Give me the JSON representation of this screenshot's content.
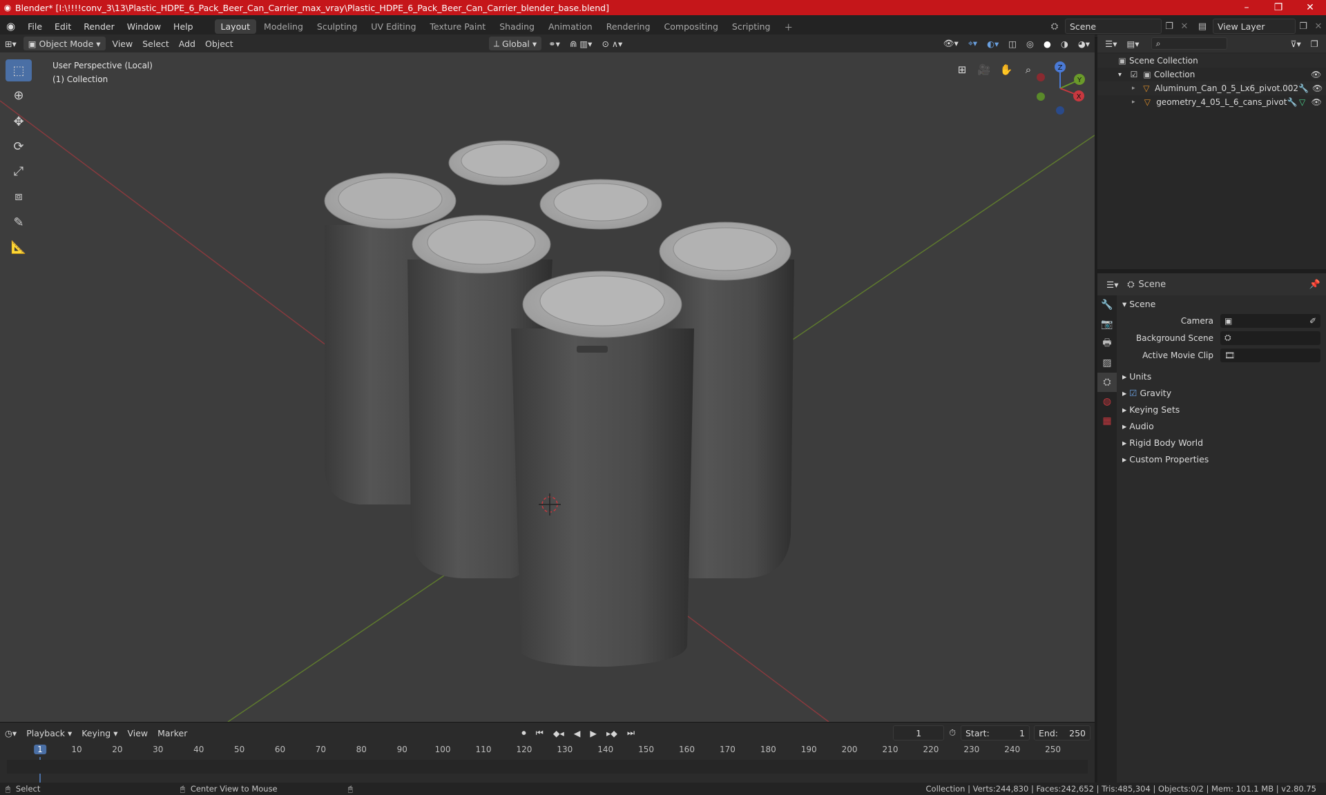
{
  "titlebar": {
    "title": "Blender* [I:\\!!!!conv_3\\13\\Plastic_HDPE_6_Pack_Beer_Can_Carrier_max_vray\\Plastic_HDPE_6_Pack_Beer_Can_Carrier_blender_base.blend]",
    "minimize": "–",
    "maximize": "❐",
    "close": "✕"
  },
  "menu": {
    "items": [
      "File",
      "Edit",
      "Render",
      "Window",
      "Help"
    ],
    "workspaces": [
      "Layout",
      "Modeling",
      "Sculpting",
      "UV Editing",
      "Texture Paint",
      "Shading",
      "Animation",
      "Rendering",
      "Compositing",
      "Scripting"
    ],
    "active_workspace": "Layout",
    "scene_label": "Scene",
    "view_layer_label": "View Layer"
  },
  "viewport_header": {
    "mode": "Object Mode",
    "menus": [
      "View",
      "Select",
      "Add",
      "Object"
    ],
    "transform": "Global"
  },
  "viewport": {
    "perspective": "User Perspective (Local)",
    "collection": "(1) Collection",
    "axis_x": "X",
    "axis_y": "Y",
    "axis_z": "Z"
  },
  "outliner": {
    "root": "Scene Collection",
    "collection": "Collection",
    "objects": [
      "Aluminum_Can_0_5_Lx6_pivot.002",
      "geometry_4_05_L_6_cans_pivot"
    ]
  },
  "properties": {
    "header": "Scene",
    "section": "Scene",
    "fields": [
      {
        "label": "Camera",
        "value": ""
      },
      {
        "label": "Background Scene",
        "value": ""
      },
      {
        "label": "Active Movie Clip",
        "value": ""
      }
    ],
    "panels": [
      "Units",
      "Gravity",
      "Keying Sets",
      "Audio",
      "Rigid Body World",
      "Custom Properties"
    ],
    "gravity_checked": true
  },
  "timeline": {
    "menus": [
      "Playback",
      "Keying",
      "View",
      "Marker"
    ],
    "current_frame": "1",
    "start_label": "Start:",
    "start": "1",
    "end_label": "End:",
    "end": "250",
    "ticks": [
      "1",
      "10",
      "20",
      "30",
      "40",
      "50",
      "60",
      "70",
      "80",
      "90",
      "100",
      "110",
      "120",
      "130",
      "140",
      "150",
      "160",
      "170",
      "180",
      "190",
      "200",
      "210",
      "220",
      "230",
      "240",
      "250"
    ]
  },
  "statusbar": {
    "left": "Select",
    "middle": "Center View to Mouse",
    "stats": "Collection | Verts:244,830 | Faces:242,652 | Tris:485,304 | Objects:0/2 | Mem: 101.1 MB | v2.80.75"
  },
  "colors": {
    "title_red": "#c5161a",
    "accent_blue": "#4a6fa5",
    "axis_red": "#c8383f",
    "axis_green": "#6a9a2a"
  }
}
